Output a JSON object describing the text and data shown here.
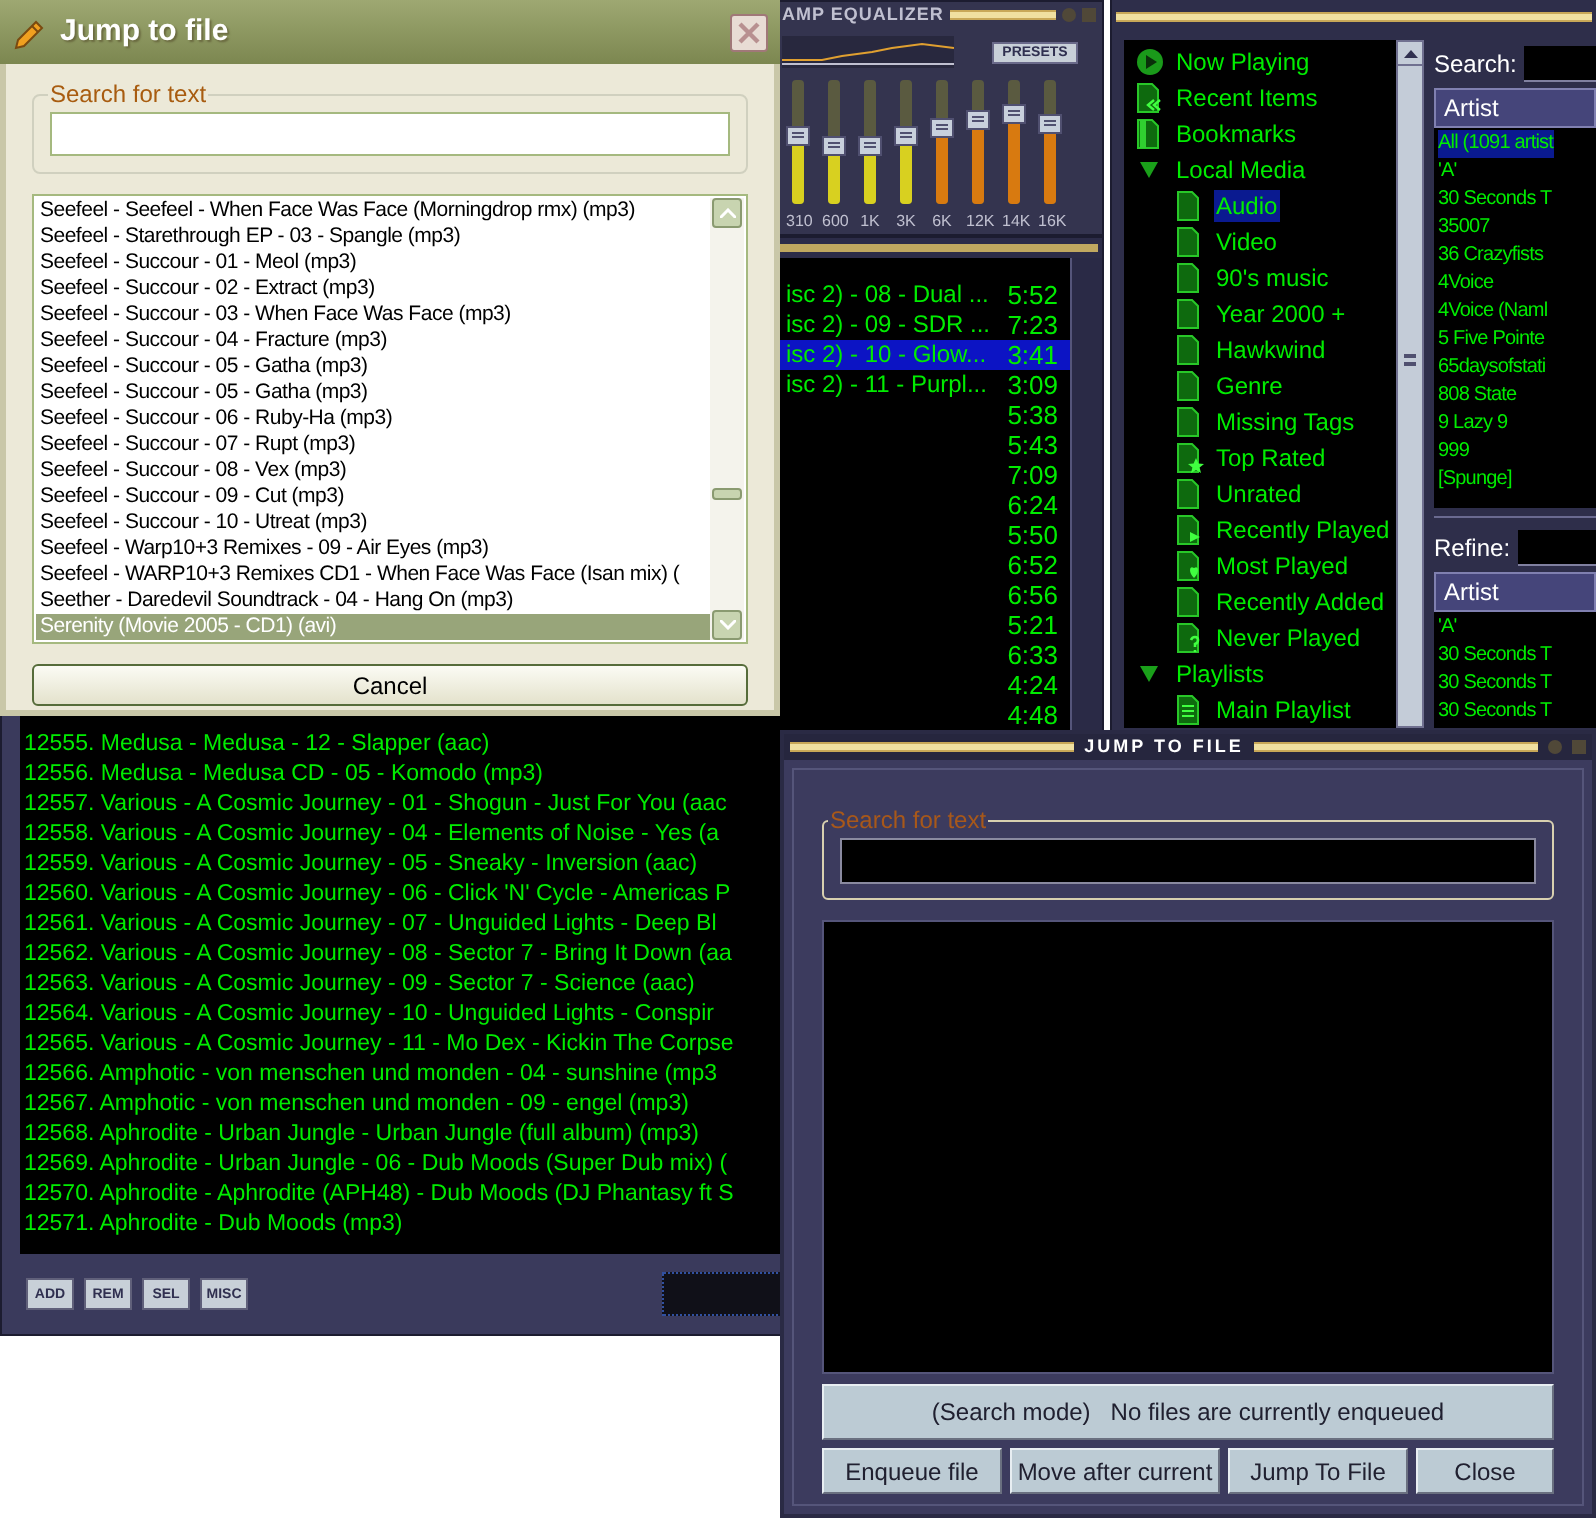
{
  "playlist": {
    "rows": [
      {
        "title": "isc 2) - 08 - Dual ...",
        "time": "5:52",
        "selected": false
      },
      {
        "title": "isc 2) - 09 - SDR ...",
        "time": "7:23",
        "selected": false
      },
      {
        "title": "isc 2) - 10 - Glow...",
        "time": "3:41",
        "selected": true
      },
      {
        "title": "isc 2) - 11 - Purpl...",
        "time": "3:09",
        "selected": false
      },
      {
        "time": "5:38",
        "selected": false
      },
      {
        "time": "5:43",
        "selected": false
      },
      {
        "time": "7:09",
        "selected": false
      },
      {
        "time": "6:24",
        "selected": false
      },
      {
        "time": "5:50",
        "selected": false
      },
      {
        "time": "6:52",
        "selected": false
      },
      {
        "time": "6:56",
        "selected": false
      },
      {
        "time": "5:21",
        "selected": false
      },
      {
        "time": "6:33",
        "selected": false
      },
      {
        "time": "4:24",
        "selected": false
      },
      {
        "time": "4:48",
        "selected": false
      },
      {
        "title": "12555. Medusa - Medusa - 12 - Slapper (aac)",
        "selected": false
      },
      {
        "title": "12556. Medusa - Medusa CD - 05 - Komodo (mp3)",
        "selected": false
      },
      {
        "title": "12557. Various - A Cosmic Journey - 01 - Shogun - Just For You (aac",
        "selected": false
      },
      {
        "title": "12558. Various - A Cosmic Journey - 04 - Elements of Noise - Yes (a",
        "selected": false
      },
      {
        "title": "12559. Various - A Cosmic Journey - 05 - Sneaky - Inversion (aac)",
        "selected": false
      },
      {
        "title": "12560. Various - A Cosmic Journey - 06 - Click 'N' Cycle - Americas P",
        "selected": false
      },
      {
        "title": "12561. Various - A Cosmic Journey - 07 - Unguided Lights - Deep Bl",
        "selected": false
      },
      {
        "title": "12562. Various - A Cosmic Journey - 08 - Sector 7 - Bring It Down (aa",
        "selected": false
      },
      {
        "title": "12563. Various - A Cosmic Journey - 09 - Sector 7 - Science (aac)",
        "selected": false
      },
      {
        "title": "12564. Various - A Cosmic Journey - 10 - Unguided Lights - Conspir",
        "selected": false
      },
      {
        "title": "12565. Various - A Cosmic Journey - 11 - Mo Dex - Kickin The Corpse",
        "selected": false
      },
      {
        "title": "12566. Amphotic - von menschen und monden - 04 - sunshine (mp3",
        "selected": false
      },
      {
        "title": "12567. Amphotic - von menschen und monden - 09 - engel (mp3)",
        "selected": false
      },
      {
        "title": "12568. Aphrodite - Urban Jungle - Urban Jungle (full album) (mp3)",
        "selected": false
      },
      {
        "title": "12569. Aphrodite - Urban Jungle - 06 - Dub Moods (Super Dub mix) (",
        "selected": false
      },
      {
        "title": "12570. Aphrodite - Aphrodite (APH48) -  Dub Moods (DJ Phantasy ft S",
        "selected": false
      },
      {
        "title": "12571. Aphrodite - Dub Moods (mp3)",
        "selected": false
      }
    ],
    "buttons": [
      "ADD",
      "REM",
      "SEL",
      "MISC"
    ]
  },
  "equalizer": {
    "title": "AMP EQUALIZER",
    "presets_button": "PRESETS",
    "bands": [
      {
        "label": "310",
        "level": 0.55
      },
      {
        "label": "600",
        "level": 0.47
      },
      {
        "label": "1K",
        "level": 0.47
      },
      {
        "label": "3K",
        "level": 0.55
      },
      {
        "label": "6K",
        "level": 0.62
      },
      {
        "label": "12K",
        "level": 0.68
      },
      {
        "label": "14K",
        "level": 0.73
      },
      {
        "label": "16K",
        "level": 0.65
      }
    ]
  },
  "media_library": {
    "tree": [
      {
        "label": "Now Playing",
        "kind": "play",
        "selected": false
      },
      {
        "label": "Recent Items",
        "kind": "recent",
        "selected": false
      },
      {
        "label": "Bookmarks",
        "kind": "bookmark",
        "selected": false
      },
      {
        "label": "Local Media",
        "kind": "group",
        "expanded": true,
        "selected": false,
        "children": [
          {
            "label": "Audio",
            "kind": "view",
            "selected": true
          },
          {
            "label": "Video",
            "kind": "view",
            "selected": false
          },
          {
            "label": "90's music",
            "kind": "view",
            "selected": false
          },
          {
            "label": "Year 2000 +",
            "kind": "view",
            "selected": false
          },
          {
            "label": "Hawkwind",
            "kind": "view",
            "selected": false
          },
          {
            "label": "Genre",
            "kind": "view",
            "selected": false
          },
          {
            "label": "Missing Tags",
            "kind": "view",
            "selected": false
          },
          {
            "label": "Top Rated",
            "kind": "star",
            "selected": false
          },
          {
            "label": "Unrated",
            "kind": "view",
            "selected": false
          },
          {
            "label": "Recently Played",
            "kind": "replay",
            "selected": false
          },
          {
            "label": "Most Played",
            "kind": "heart",
            "selected": false
          },
          {
            "label": "Recently Added",
            "kind": "view",
            "selected": false
          },
          {
            "label": "Never Played",
            "kind": "question",
            "selected": false
          }
        ]
      },
      {
        "label": "Playlists",
        "kind": "group",
        "expanded": true,
        "selected": false,
        "children": [
          {
            "label": "Main Playlist",
            "kind": "playlist",
            "selected": false
          }
        ]
      }
    ],
    "search_label": "Search:",
    "artist_header": "Artist",
    "artists": [
      {
        "name": "All (1091 artist",
        "selected": true
      },
      {
        "name": "'A'",
        "selected": false
      },
      {
        "name": "30 Seconds T",
        "selected": false
      },
      {
        "name": "35007",
        "selected": false
      },
      {
        "name": "36 Crazyfists",
        "selected": false
      },
      {
        "name": "4Voice",
        "selected": false
      },
      {
        "name": "4Voice (Naml",
        "selected": false
      },
      {
        "name": "5 Five Pointe",
        "selected": false
      },
      {
        "name": "65daysofstati",
        "selected": false
      },
      {
        "name": "808 State",
        "selected": false
      },
      {
        "name": "9 Lazy 9",
        "selected": false
      },
      {
        "name": "999",
        "selected": false
      },
      {
        "name": "[Spunge]",
        "selected": false
      }
    ],
    "refine_label": "Refine:",
    "refine_header": "Artist",
    "refine_artists": [
      {
        "name": "'A'",
        "selected": false
      },
      {
        "name": "30 Seconds T",
        "selected": false
      },
      {
        "name": "30 Seconds T",
        "selected": false
      },
      {
        "name": "30 Seconds T",
        "selected": false
      }
    ]
  },
  "jump_dialog": {
    "title": "Jump to file",
    "search_legend": "Search for text",
    "files": [
      {
        "name": "Seefeel - Seefeel - When Face Was Face (Morningdrop rmx) (mp3)",
        "selected": false
      },
      {
        "name": "Seefeel - Starethrough EP - 03 - Spangle (mp3)",
        "selected": false
      },
      {
        "name": "Seefeel - Succour - 01 - Meol (mp3)",
        "selected": false
      },
      {
        "name": "Seefeel - Succour - 02 - Extract (mp3)",
        "selected": false
      },
      {
        "name": "Seefeel - Succour - 03 - When Face Was Face (mp3)",
        "selected": false
      },
      {
        "name": "Seefeel - Succour - 04 - Fracture (mp3)",
        "selected": false
      },
      {
        "name": "Seefeel - Succour - 05 - Gatha (mp3)",
        "selected": false
      },
      {
        "name": "Seefeel - Succour - 05 - Gatha (mp3)",
        "selected": false
      },
      {
        "name": "Seefeel - Succour - 06 - Ruby-Ha (mp3)",
        "selected": false
      },
      {
        "name": "Seefeel - Succour - 07 - Rupt (mp3)",
        "selected": false
      },
      {
        "name": "Seefeel - Succour - 08 - Vex (mp3)",
        "selected": false
      },
      {
        "name": "Seefeel - Succour - 09 - Cut (mp3)",
        "selected": false
      },
      {
        "name": "Seefeel - Succour - 10 - Utreat (mp3)",
        "selected": false
      },
      {
        "name": "Seefeel - Warp10+3 Remixes - 09 - Air Eyes (mp3)",
        "selected": false
      },
      {
        "name": "Seefeel - WARP10+3 Remixes CD1 - When Face Was Face (Isan mix) (",
        "selected": false
      },
      {
        "name": "Seether - Daredevil Soundtrack - 04 - Hang On (mp3)",
        "selected": false
      },
      {
        "name": "Serenity (Movie 2005 - CD1) (avi)",
        "selected": true
      }
    ],
    "cancel_button": "Cancel"
  },
  "skinned_jump_dialog": {
    "title": "JUMP TO FILE",
    "search_legend": "Search for text",
    "status": "(Search mode)   No files are currently enqueued",
    "buttons": [
      "Enqueue file",
      "Move after current",
      "Jump To File",
      "Close"
    ]
  }
}
